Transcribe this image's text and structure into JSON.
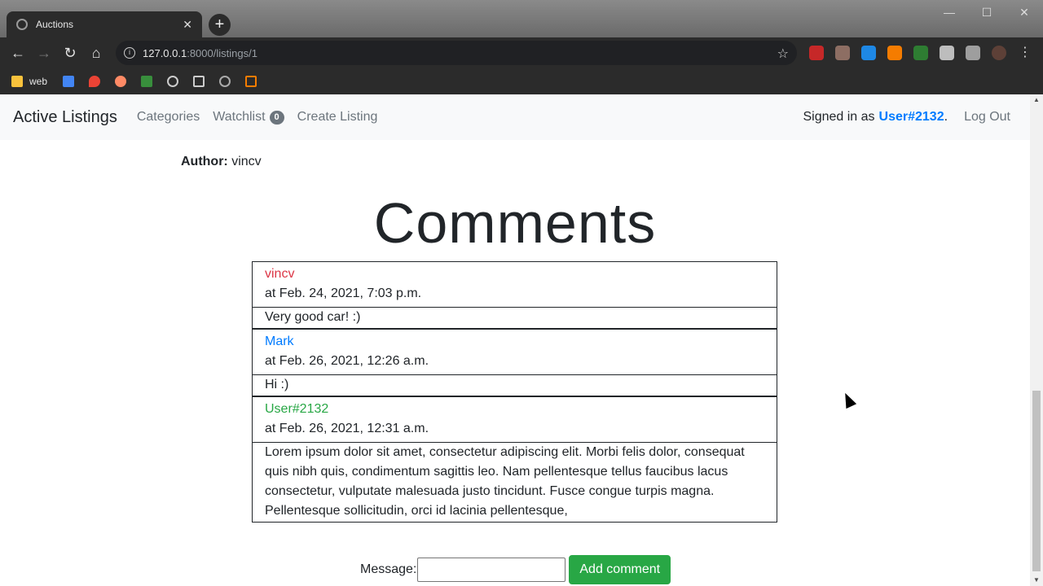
{
  "browser": {
    "tab_title": "Auctions",
    "tab_close": "✕",
    "new_tab": "+",
    "url_host": "127.0.0.1",
    "url_path": ":8000/listings/1",
    "bookmarks": [
      {
        "label": "web"
      }
    ]
  },
  "navbar": {
    "brand": "Active Listings",
    "categories": "Categories",
    "watchlist": "Watchlist",
    "watchlist_count": "0",
    "create_listing": "Create Listing",
    "signed_in_prefix": "Signed in as",
    "username": "User#2132",
    "signed_in_suffix": ".",
    "logout": "Log Out"
  },
  "listing": {
    "author_label": "Author:",
    "author": "vincv"
  },
  "comments_heading": "Comments",
  "comments": [
    {
      "author": "vincv",
      "color": "#dc3545",
      "time": "at Feb. 24, 2021, 7:03 p.m.",
      "text": "Very good car! :)"
    },
    {
      "author": "Mark",
      "color": "#007bff",
      "time": "at Feb. 26, 2021, 12:26 a.m.",
      "text": "Hi :)"
    },
    {
      "author": "User#2132",
      "color": "#28a745",
      "time": "at Feb. 26, 2021, 12:31 a.m.",
      "text": "Lorem ipsum dolor sit amet, consectetur adipiscing elit. Morbi felis dolor, consequat quis nibh quis, condimentum sagittis leo. Nam pellentesque tellus faucibus lacus consectetur, vulputate malesuada justo tincidunt. Fusce congue turpis magna. Pellentesque sollicitudin, orci id lacinia pellentesque,"
    }
  ],
  "form": {
    "message_label": "Message:",
    "message_value": "",
    "submit_label": "Add comment"
  }
}
